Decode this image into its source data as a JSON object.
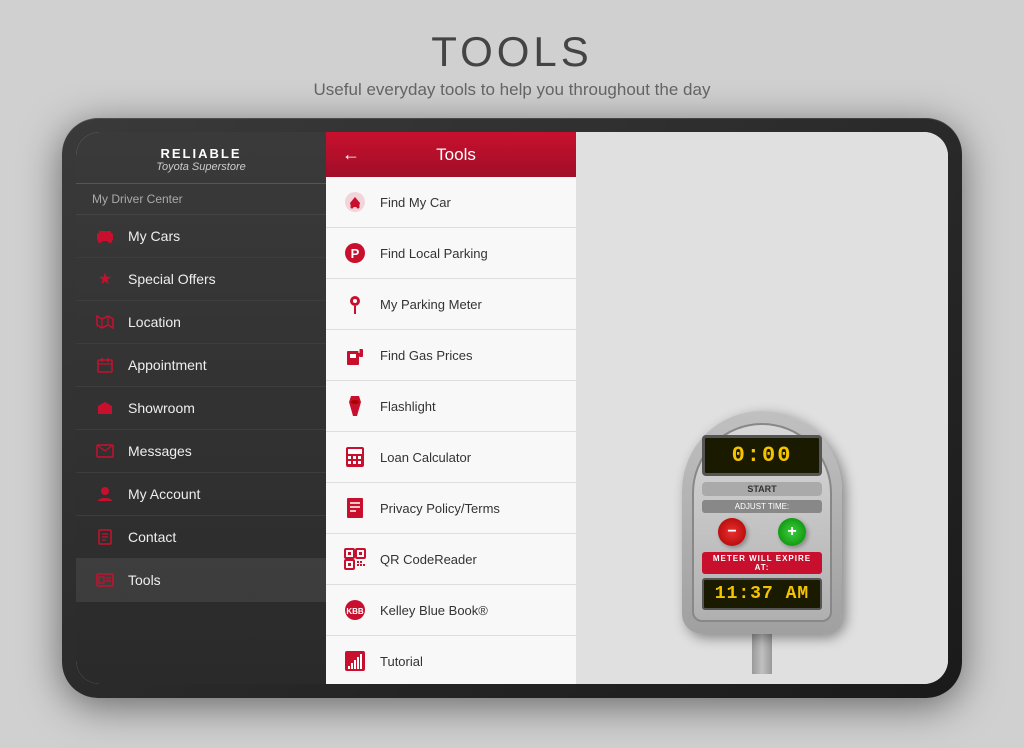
{
  "page": {
    "title": "TOOLS",
    "subtitle": "Useful everyday tools to help you throughout the day"
  },
  "sidebar": {
    "logo": {
      "reliable": "RELIABLE",
      "toyota": "Toyota Superstore"
    },
    "driver_center_label": "My Driver Center",
    "items": [
      {
        "id": "my-cars",
        "label": "My Cars",
        "icon": "🏠"
      },
      {
        "id": "special-offers",
        "label": "Special Offers",
        "icon": "★"
      },
      {
        "id": "location",
        "label": "Location",
        "icon": "🗺"
      },
      {
        "id": "appointment",
        "label": "Appointment",
        "icon": "📅"
      },
      {
        "id": "showroom",
        "label": "Showroom",
        "icon": "🚗"
      },
      {
        "id": "messages",
        "label": "Messages",
        "icon": "✉"
      },
      {
        "id": "my-account",
        "label": "My Account",
        "icon": "👤"
      },
      {
        "id": "contact",
        "label": "Contact",
        "icon": "📋"
      },
      {
        "id": "tools",
        "label": "Tools",
        "icon": "🧰"
      }
    ]
  },
  "tools_panel": {
    "title": "Tools",
    "back_label": "←",
    "items": [
      {
        "id": "find-my-car",
        "label": "Find My Car",
        "icon": "🚗"
      },
      {
        "id": "find-local-parking",
        "label": "Find Local Parking",
        "icon": "🅿"
      },
      {
        "id": "my-parking-meter",
        "label": "My Parking Meter",
        "icon": "📍"
      },
      {
        "id": "find-gas-prices",
        "label": "Find Gas Prices",
        "icon": "⛽"
      },
      {
        "id": "flashlight",
        "label": "Flashlight",
        "icon": "🔦"
      },
      {
        "id": "loan-calculator",
        "label": "Loan Calculator",
        "icon": "🧮"
      },
      {
        "id": "privacy-policy",
        "label": "Privacy Policy/Terms",
        "icon": "📄"
      },
      {
        "id": "qr-codereader",
        "label": "QR CodeReader",
        "icon": "▦"
      },
      {
        "id": "kelley-blue-book",
        "label": "Kelley Blue Book®",
        "icon": "📖"
      },
      {
        "id": "tutorial",
        "label": "Tutorial",
        "icon": "📊"
      }
    ]
  },
  "meter": {
    "display_time": "0:00",
    "start_label": "START",
    "adjust_time_label": "ADJUST TIME:",
    "expire_label": "METER WILL EXPIRE AT:",
    "expire_time": "11:37 AM",
    "minus_label": "−",
    "plus_label": "+"
  }
}
